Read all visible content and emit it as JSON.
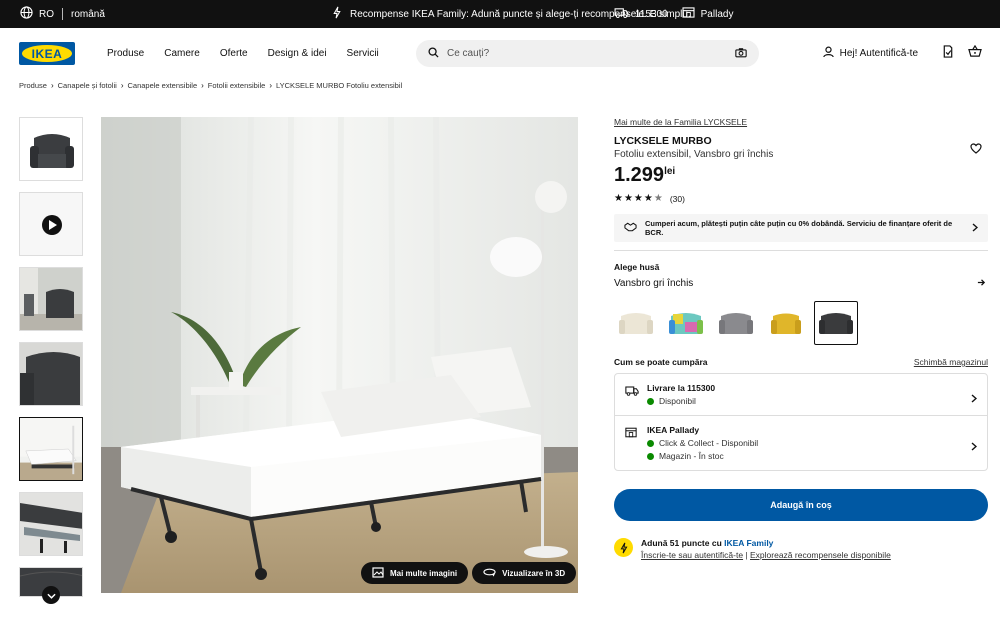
{
  "topbar": {
    "country": "RO",
    "language": "română",
    "promo": "Recompense IKEA Family: Adună puncte și alege-ți recompensele. E simplu.",
    "postal_code": "115300",
    "store": "Pallady"
  },
  "header": {
    "logo_text": "IKEA",
    "nav": [
      "Produse",
      "Camere",
      "Oferte",
      "Design & idei",
      "Servicii"
    ],
    "search_placeholder": "Ce cauți?",
    "login": "Hej! Autentifică-te"
  },
  "breadcrumb": [
    "Produse",
    "Canapele și fotolii",
    "Canapele extensibile",
    "Fotolii extensibile",
    "LYCKSELE MURBO Fotoliu extensibil"
  ],
  "gallery": {
    "more_images": "Mai multe imagini",
    "view_3d": "Vizualizare în 3D"
  },
  "product": {
    "family_link": "Mai multe de la Familia LYCKSELE",
    "name": "LYCKSELE MURBO",
    "description": "Fotoliu extensibil, Vansbro gri închis",
    "price": "1.299",
    "currency": "lei",
    "rating_value": 4.5,
    "reviews": "(30)",
    "finance_text": "Cumperi acum, plătești puțin câte puțin cu 0% dobândă. Serviciu de finanțare oferit de BCR.",
    "cover_label": "Alege husă",
    "cover_value": "Vansbro gri închis",
    "swatch_colors": [
      "#ece6d6",
      "#6cc8c0",
      "#8a8a8e",
      "#e0b62a",
      "#3a3b3d"
    ],
    "how_to_buy": "Cum se poate cumpăra",
    "change_store": "Schimbă magazinul",
    "delivery_title": "Livrare la 115300",
    "delivery_status": "Disponibil",
    "store_title": "IKEA Pallady",
    "store_status_1": "Click & Collect - Disponibil",
    "store_status_2": "Magazin - În stoc",
    "add_to_cart": "Adaugă în coș",
    "family_points_prefix": "Adună 51 puncte cu ",
    "family_name": "IKEA Family",
    "family_signin": "Înscrie-te sau autentifică-te",
    "family_sep": " | ",
    "family_explore": "Explorează recompensele disponibile"
  }
}
